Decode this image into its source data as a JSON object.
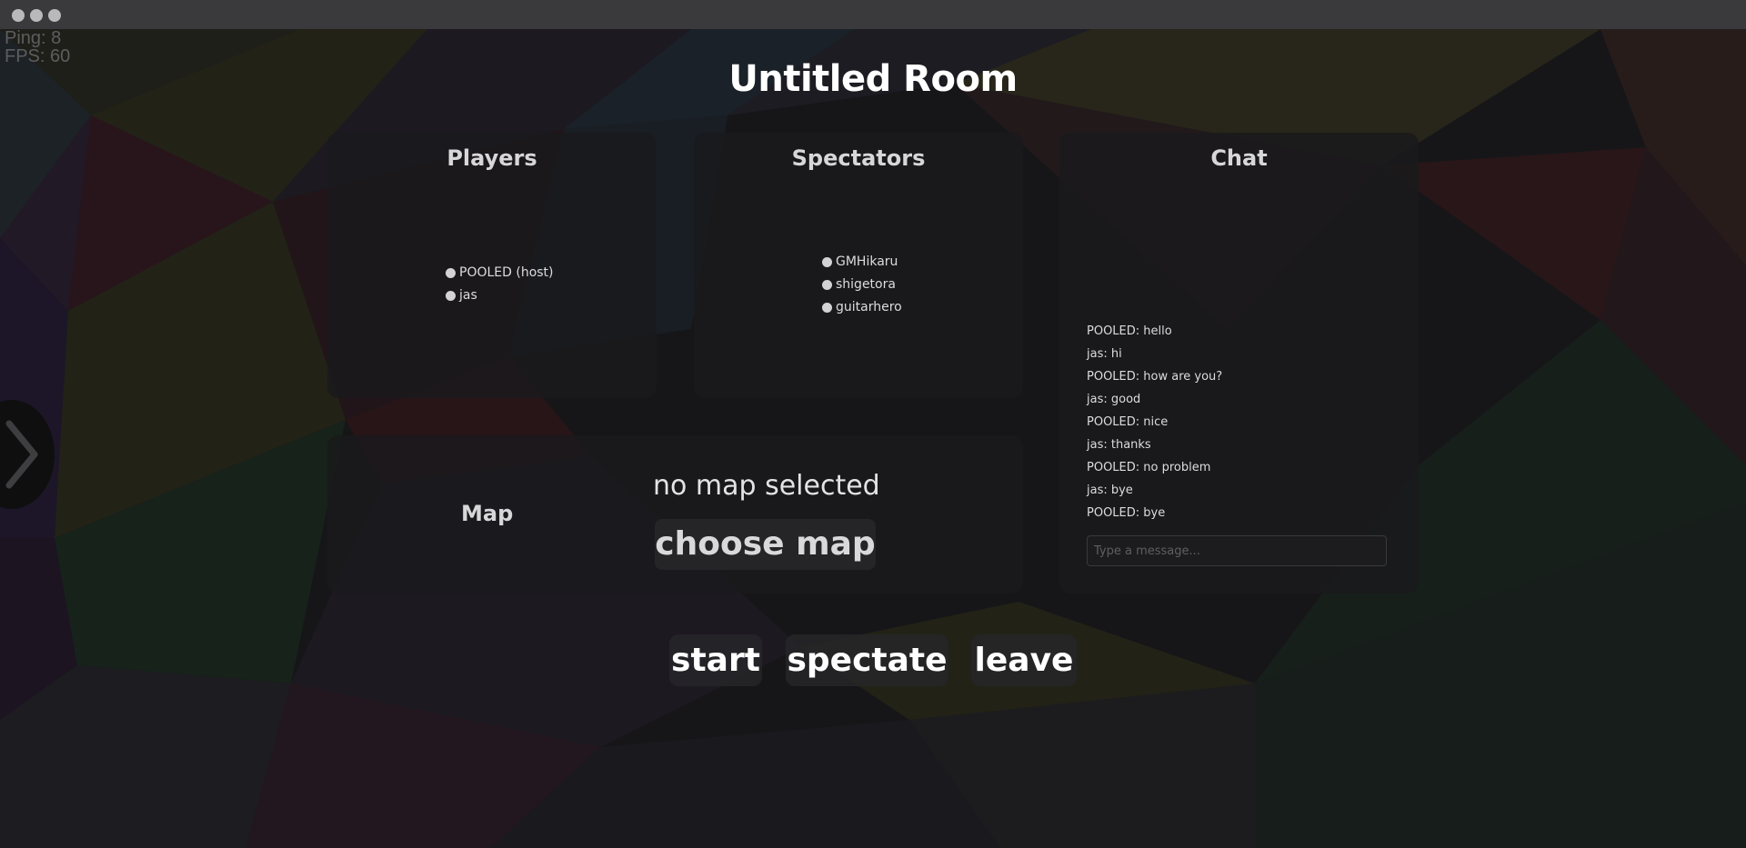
{
  "stats": {
    "ping": "Ping: 8",
    "fps": "FPS: 60"
  },
  "room": {
    "title": "Untitled Room"
  },
  "players": {
    "title": "Players",
    "items": [
      "POOLED (host)",
      "jas"
    ]
  },
  "spectators": {
    "title": "Spectators",
    "items": [
      "GMHikaru",
      "shigetora",
      "guitarhero"
    ]
  },
  "chat": {
    "title": "Chat",
    "messages": [
      "POOLED: hello",
      "jas: hi",
      "POOLED: how are you?",
      "jas: good",
      "POOLED: nice",
      "jas: thanks",
      "POOLED: no problem",
      "jas: bye",
      "POOLED: bye"
    ],
    "input_placeholder": "Type a message..."
  },
  "map": {
    "label": "Map",
    "status": "no map selected",
    "choose_label": "choose map"
  },
  "actions": {
    "start_label": "start",
    "spectate_label": "spectate",
    "leave_label": "leave"
  },
  "icons": {
    "sidebar_toggle": "chevron-right-icon"
  }
}
